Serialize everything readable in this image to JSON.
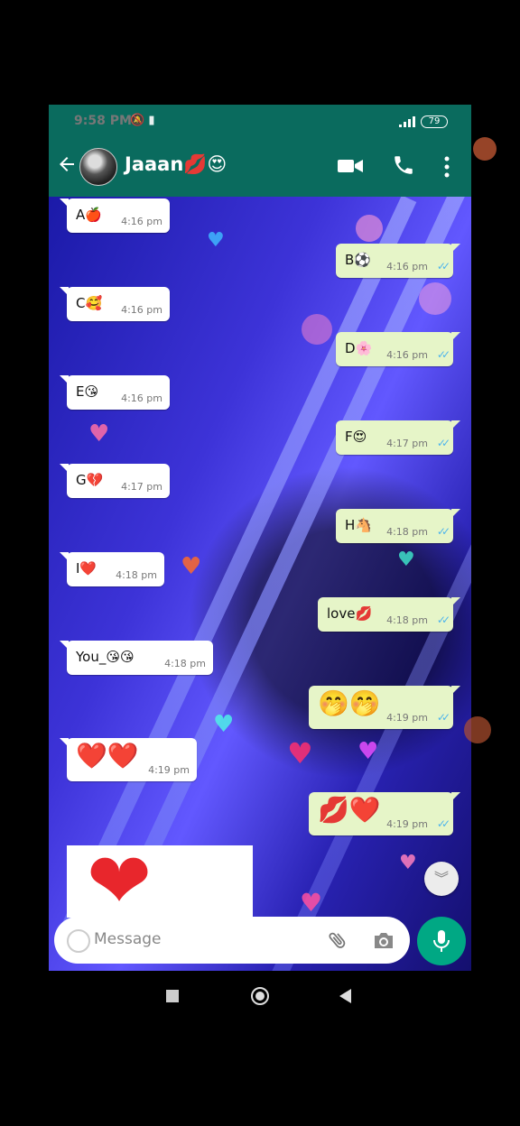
{
  "status": {
    "time": "9:58 PM",
    "battery": "79"
  },
  "header": {
    "contact_name": "Jaaan💋😍"
  },
  "messages": [
    {
      "dir": "in",
      "text": "A🍎",
      "time": "4:16 pm"
    },
    {
      "dir": "out",
      "text": "B⚽",
      "time": "4:16 pm"
    },
    {
      "dir": "in",
      "text": "C🥰",
      "time": "4:16 pm"
    },
    {
      "dir": "out",
      "text": "D🌸",
      "time": "4:16 pm"
    },
    {
      "dir": "in",
      "text": "E😘",
      "time": "4:16 pm"
    },
    {
      "dir": "out",
      "text": "F😍",
      "time": "4:17 pm"
    },
    {
      "dir": "in",
      "text": "G💔",
      "time": "4:17 pm"
    },
    {
      "dir": "out",
      "text": "H🐴",
      "time": "4:18 pm"
    },
    {
      "dir": "in",
      "text": "I❤️",
      "time": "4:18 pm"
    },
    {
      "dir": "out",
      "text": "love💋",
      "time": "4:18 pm"
    },
    {
      "dir": "in",
      "text": "You_😘😘",
      "time": "4:18 pm"
    },
    {
      "dir": "out",
      "text": "🤭🤭",
      "time": "4:19 pm"
    },
    {
      "dir": "in",
      "text": "❤️❤️",
      "time": "4:19 pm"
    },
    {
      "dir": "out",
      "text": "💋❤️",
      "time": "4:19 pm"
    }
  ],
  "big_heart": "❤",
  "input": {
    "placeholder": "Message"
  },
  "icons": {
    "back": "arrow-left-icon",
    "video": "video-camera-icon",
    "call": "phone-icon",
    "menu": "more-vert-icon",
    "emoji": "emoji-icon",
    "attach": "paperclip-icon",
    "camera": "camera-icon",
    "mic": "microphone-icon",
    "scroll": "double-chevron-down-icon"
  },
  "colors": {
    "header": "#0a6b5e",
    "out_bubble": "#e6f5c8",
    "in_bubble": "#ffffff",
    "mic": "#00a884",
    "ticks": "#4fb5ec"
  }
}
